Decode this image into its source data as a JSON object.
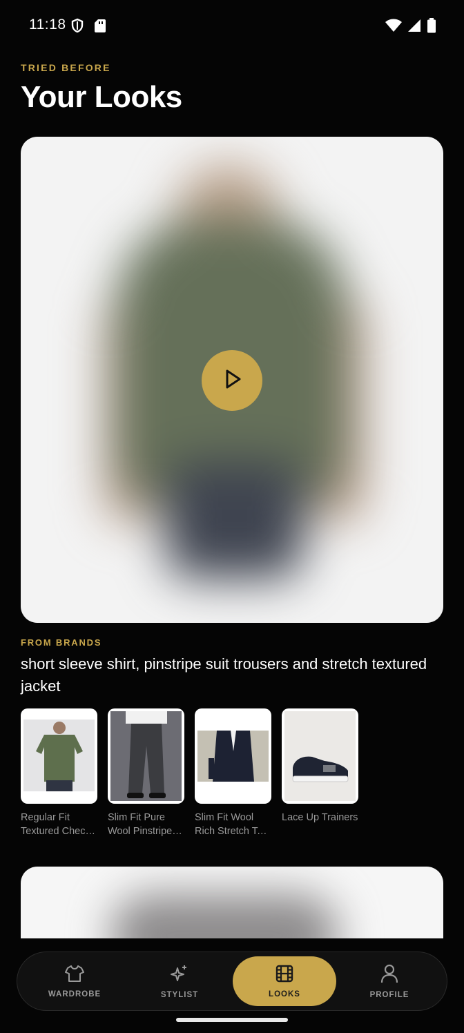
{
  "status_bar": {
    "time": "11:18",
    "left_icons": [
      "shield-icon",
      "sd-card-icon"
    ],
    "right_icons": [
      "wifi-icon",
      "cell-signal-icon",
      "battery-icon"
    ]
  },
  "header": {
    "eyebrow": "TRIED BEFORE",
    "title": "Your Looks"
  },
  "look": {
    "brands_label": "FROM BRANDS",
    "description": "short sleeve shirt, pinstripe suit trousers and stretch textured jacket",
    "products": [
      {
        "name_line1": "Regular Fit",
        "name_line2": "Textured Check Short Sleeve Shirt"
      },
      {
        "name_line1": "Slim Fit Pure",
        "name_line2": "Wool Pinstripe Suit Trousers"
      },
      {
        "name_line1": "Slim Fit Wool",
        "name_line2": "Rich Stretch Textured Jacket"
      },
      {
        "name_line1": "Lace Up Trainers",
        "name_line2": ""
      }
    ]
  },
  "nav": {
    "items": [
      {
        "label": "WARDROBE",
        "icon": "shirt-icon"
      },
      {
        "label": "STYLIST",
        "icon": "sparkles-icon"
      },
      {
        "label": "LOOKS",
        "icon": "film-icon",
        "active": true
      },
      {
        "label": "PROFILE",
        "icon": "person-icon"
      }
    ]
  },
  "colors": {
    "accent": "#c9a74c",
    "background": "#050505"
  }
}
